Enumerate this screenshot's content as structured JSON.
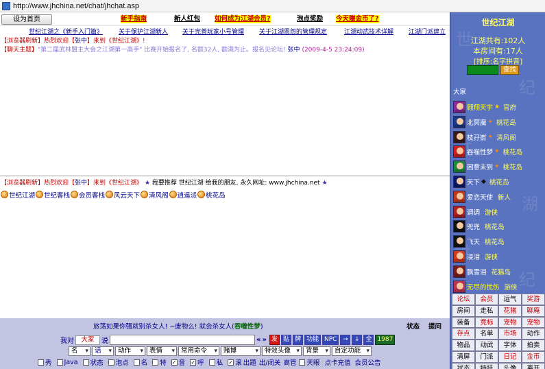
{
  "browser": {
    "url": "http://www.jhchina.net/chat/jhchat.asp"
  },
  "topbar": {
    "home_button": "设为首页",
    "links": [
      {
        "label": "新手指南",
        "style": "y"
      },
      {
        "label": "新人红包",
        "style": "w"
      },
      {
        "label": "如何成为江湖会员?",
        "style": "y"
      },
      {
        "label": "泡点奖励",
        "style": "w"
      },
      {
        "label": "今天赚金币了?",
        "style": "y"
      }
    ]
  },
  "subnav": [
    "世纪江湖之《新手入门篇》",
    "关于保护江湖新人",
    "关于完善玩家小号管理",
    "关于江湖恩怨的管理规定",
    "江湖动武技术详解",
    "江湖门派建立"
  ],
  "upper": {
    "line1": {
      "tag": "【浏览器刷新】",
      "text_a": "热烈欢迎【",
      "name": "张中",
      "text_b": "】来到《世纪江湖》!"
    },
    "line2": {
      "tag": "【聊天主题】",
      "text": "\"第二届武林盟主大会之江湖第一高手\" 比赛开始报名了, 名额32人, 额满为止。报名见论坛!",
      "author": "张中",
      "time": "(2009-4-5 23:24:09)"
    }
  },
  "lower": {
    "line1": {
      "tag": "【浏览器刷新】",
      "text_a": "热烈欢迎【",
      "name": "张中",
      "text_b": "】来到《世纪江湖》",
      "star": "★",
      "promo": "我要推荐 世纪江湖 给我的朋友, 永久网址:",
      "url": "www.jhchina.net"
    },
    "rooms": [
      "世纪江湖",
      "世纪客栈",
      "会员客栈",
      "风云天下",
      "清风阁",
      "逍遥派",
      "桃花岛"
    ]
  },
  "bottom": {
    "marquee_a": "旅荡如果你强就别杀女人! ~废物么! 就会杀女人(",
    "marquee_name": "吞噬性梦",
    "marquee_b": ")",
    "status": "状态",
    "refresh": "提问",
    "to_label": "我对",
    "to_value": "大家",
    "say_label": "说",
    "buttons": [
      {
        "label": "«",
        "type": "dbl"
      },
      {
        "label": "»",
        "type": "dbl"
      },
      {
        "label": "发",
        "type": "red"
      },
      {
        "label": "贴",
        "type": "blue"
      },
      {
        "label": "牌",
        "type": "blue"
      },
      {
        "label": "功能",
        "type": "blue"
      },
      {
        "label": "NPC",
        "type": "blue"
      },
      {
        "label": "→",
        "type": "blue"
      },
      {
        "label": "↓",
        "type": "blue"
      },
      {
        "label": "全",
        "type": "blue"
      },
      {
        "label": "1987",
        "type": "grn"
      }
    ],
    "selects": [
      {
        "label": "名",
        "width": 32
      },
      {
        "label": "话",
        "width": 32
      },
      {
        "label": "动作",
        "width": 44
      },
      {
        "label": "表情",
        "width": 44
      },
      {
        "label": "常用命令",
        "width": 60
      },
      {
        "label": "赌博",
        "width": 58
      },
      {
        "label": "特效头像",
        "width": 58
      },
      {
        "label": "背景",
        "width": 40
      },
      {
        "label": "自定功能",
        "width": 58
      }
    ],
    "checks": [
      {
        "label": "秀",
        "checked": false
      },
      {
        "label": "Java",
        "checked": false
      },
      {
        "label": "状态",
        "checked": false
      },
      {
        "label": "泡点",
        "checked": false
      },
      {
        "label": "名",
        "checked": false
      },
      {
        "label": "特",
        "checked": false
      },
      {
        "label": "音",
        "checked": true
      },
      {
        "label": "呼",
        "checked": true
      },
      {
        "label": "私",
        "checked": false
      },
      {
        "label": "滚",
        "checked": true
      },
      {
        "label": "出题",
        "checked": null
      },
      {
        "label": "出/闭关",
        "checked": null
      },
      {
        "label": "高管",
        "checked": null
      },
      {
        "label": "天眼",
        "checked": false
      },
      {
        "label": "点卡充值",
        "checked": null
      },
      {
        "label": "会员公告",
        "checked": null
      }
    ]
  },
  "sidebar": {
    "title": "世纪江湖",
    "total": "江湖共有:102人",
    "room": "本房间有:17人",
    "sort_a": "[排序:",
    "sort_b": "名字拼音",
    "sort_c": "]",
    "find_button": "查找",
    "everyone": "大家",
    "users": [
      {
        "name": "翱翔天宇",
        "deco": "★",
        "room": "官府",
        "namecolor": "#ffff00",
        "avatar": "#8a2a9a",
        "decocolor": "#ffd400"
      },
      {
        "name": "北冥魔",
        "deco": "✦",
        "room": "桃花岛",
        "namecolor": "#ffffff",
        "avatar": "#1a3a8a",
        "decocolor": "#ff8a00"
      },
      {
        "name": "枝孖嵛",
        "deco": "✦",
        "room": "清风阁",
        "namecolor": "#ffffff",
        "avatar": "#3a1a1a",
        "decocolor": "#ff8a00"
      },
      {
        "name": "吞噬性梦",
        "deco": "✦",
        "room": "桃花岛",
        "namecolor": "#ffffff",
        "avatar": "#d02020",
        "decocolor": "#ff8a00"
      },
      {
        "name": "困意未到",
        "deco": "✦",
        "room": "桃花岛",
        "namecolor": "#ffffff",
        "avatar": "#1a8a3a",
        "decocolor": "#ff8a00"
      },
      {
        "name": "天下",
        "deco": "◆",
        "room": "桃花岛",
        "namecolor": "#ffffff",
        "avatar": "#0a1a6a",
        "decocolor": "#111111"
      },
      {
        "name": "爱恋天使",
        "deco": "",
        "room": "新人",
        "namecolor": "#ffffff",
        "avatar": "#c03a1a",
        "decocolor": "#ffffff"
      },
      {
        "name": "调调",
        "deco": "",
        "room": "游侠",
        "namecolor": "#ffffff",
        "avatar": "#b02020",
        "decocolor": "#ffffff"
      },
      {
        "name": "兜兜",
        "deco": "",
        "room": "桃花岛",
        "namecolor": "#ffffff",
        "avatar": "#111111",
        "decocolor": "#ffffff"
      },
      {
        "name": "飞天",
        "deco": "",
        "room": "桃花岛",
        "namecolor": "#ffffff",
        "avatar": "#111111",
        "decocolor": "#ffffff"
      },
      {
        "name": "浸泪",
        "deco": "",
        "room": "游侠",
        "namecolor": "#ffffff",
        "avatar": "#d03a1a",
        "decocolor": "#ffffff"
      },
      {
        "name": "飘雪泪",
        "deco": "",
        "room": "花猫岛",
        "namecolor": "#ffffff",
        "avatar": "#7a1a1a",
        "decocolor": "#ffffff"
      },
      {
        "name": "无尽的忧伤",
        "deco": "",
        "room": "游侠",
        "namecolor": "#ffff00",
        "avatar": "#c03050",
        "decocolor": "#ffffff"
      }
    ],
    "grid": [
      [
        "论坛",
        "r"
      ],
      [
        "会员",
        "r"
      ],
      [
        "运气",
        ""
      ],
      [
        "奖游",
        "r"
      ],
      [
        "房间",
        ""
      ],
      [
        "走私",
        ""
      ],
      [
        "花猪",
        "r"
      ],
      [
        "聊庵",
        "r"
      ],
      [
        "装备",
        ""
      ],
      [
        "竞标",
        "r"
      ],
      [
        "宠物",
        "r"
      ],
      [
        "宠物",
        "r"
      ],
      [
        "存点",
        "r"
      ],
      [
        "名单",
        ""
      ],
      [
        "市场",
        "r"
      ],
      [
        "动作",
        ""
      ],
      [
        "物品",
        ""
      ],
      [
        "动武",
        ""
      ],
      [
        "字体",
        ""
      ],
      [
        "拍卖",
        ""
      ],
      [
        "清屏",
        ""
      ],
      [
        "门派",
        ""
      ],
      [
        "日记",
        "r"
      ],
      [
        "金币",
        "r"
      ],
      [
        "状态",
        ""
      ],
      [
        "特技",
        ""
      ],
      [
        "头像",
        ""
      ],
      [
        "离开",
        ""
      ]
    ]
  }
}
